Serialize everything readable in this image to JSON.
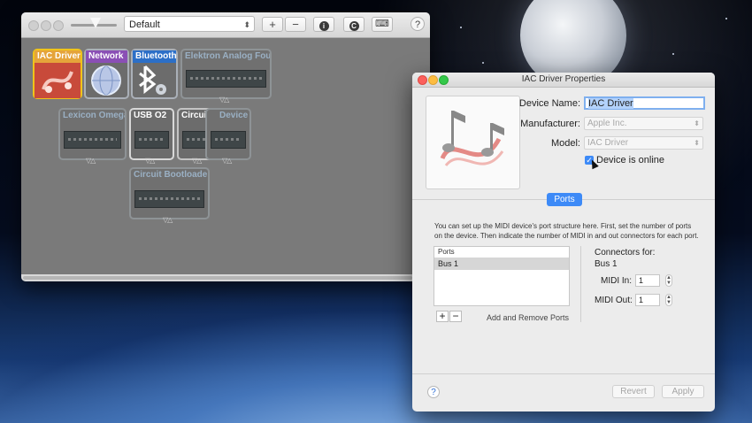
{
  "midi_window": {
    "configuration": "Default",
    "toolbar": {
      "add": "+",
      "remove": "−",
      "info": "i",
      "rescan": "C",
      "keyboard": "⌨",
      "help": "?"
    },
    "devices": [
      {
        "name": "IAC Driver",
        "label_color": "#e5a43a"
      },
      {
        "name": "Network",
        "label_color": "#8a4fb5"
      },
      {
        "name": "Bluetooth",
        "label_color": "#2c6fc7"
      },
      {
        "name": "Elektron Analog Four"
      },
      {
        "name": "Lexicon Omega"
      },
      {
        "name": "USB O2"
      },
      {
        "name": "Circuit"
      },
      {
        "name": "Device"
      },
      {
        "name": "Circuit Bootloader"
      }
    ]
  },
  "props_window": {
    "title": "IAC Driver Properties",
    "device_name_label": "Device Name:",
    "device_name_value": "IAC Driver",
    "manufacturer_label": "Manufacturer:",
    "manufacturer_value": "Apple Inc.",
    "model_label": "Model:",
    "model_value": "IAC Driver",
    "online_label": "Device is online",
    "online_checked": true,
    "tab_label": "Ports",
    "description": "You can set up the MIDI device's port structure here. First, set the number of ports on the device. Then indicate the number of MIDI in and out connectors for each port.",
    "ports_header": "Ports",
    "ports": [
      "Bus 1"
    ],
    "add_remove_label": "Add and Remove Ports",
    "connectors_for_label": "Connectors for:",
    "selected_port": "Bus 1",
    "midi_in_label": "MIDI In:",
    "midi_in_value": "1",
    "midi_out_label": "MIDI Out:",
    "midi_out_value": "1",
    "help": "?",
    "revert_label": "Revert",
    "apply_label": "Apply"
  },
  "colors": {
    "accent": "#3d8af7",
    "selection": "#b3d2fb"
  }
}
